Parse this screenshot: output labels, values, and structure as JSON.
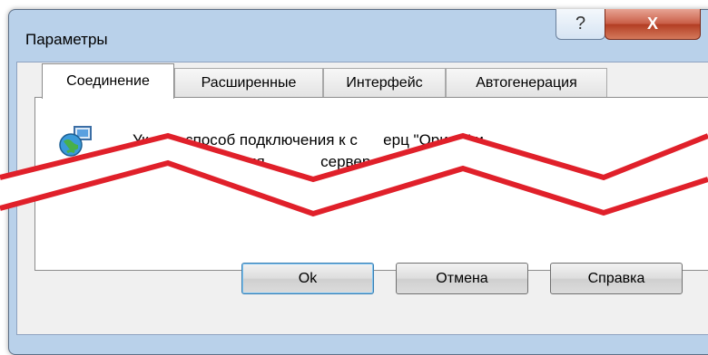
{
  "window": {
    "title": "Параметры",
    "help_glyph": "?",
    "close_glyph": "X"
  },
  "tabs": [
    {
      "label": "Соединение",
      "active": true
    },
    {
      "label": "Расширенные",
      "active": false
    },
    {
      "label": "Интерфейс",
      "active": false
    },
    {
      "label": "Автогенерация",
      "active": false
    }
  ],
  "panel": {
    "line1": "Ук    те способ подключения к с      ерц \"Орион\" и",
    "line2": "                ское имя             сервер.",
    "icon": "network-globe-icon"
  },
  "buttons": {
    "ok": "Ok",
    "cancel": "Отмена",
    "help": "Справка"
  },
  "colors": {
    "frame": "#b9d1ea",
    "close": "#c85c45",
    "cut_line": "#e0202a"
  }
}
